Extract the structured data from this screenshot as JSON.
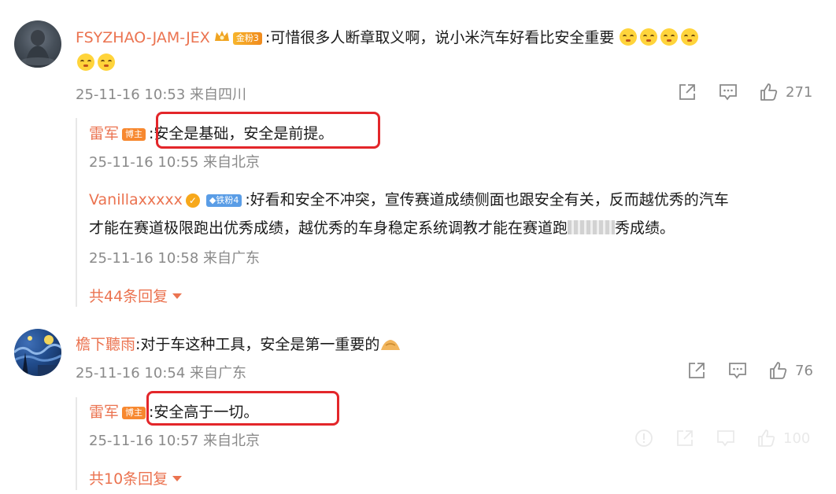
{
  "comments": [
    {
      "user": "FSYZHAO-JAM-JEX",
      "badge": "金粉3",
      "text_line1": ":可惜很多人断章取义啊，说小米汽车好看比安全重要",
      "meta": "25-11-16 10:53 来自四川",
      "likes": "271",
      "replies": [
        {
          "user": "雷军",
          "badge": "博主",
          "text": ":安全是基础，安全是前提。",
          "meta": "25-11-16 10:55 来自北京"
        },
        {
          "user": "Vanillaxxxxx",
          "badge": "铁粉4",
          "text_line1": ":好看和安全不冲突，宣传赛道成绩侧面也跟安全有关，反而越优秀的汽车",
          "text_line2a": "才能在赛道极限跑出优秀成绩，越优秀的车身稳定系统调教才能在赛道跑",
          "text_line2b": "秀成绩。",
          "meta": "25-11-16 10:58 来自广东"
        }
      ],
      "more_replies": "共44条回复"
    },
    {
      "user": "檐下聽雨",
      "text": ":对于车这种工具，安全是第一重要的",
      "meta": "25-11-16 10:54 来自广东",
      "likes": "76",
      "replies": [
        {
          "user": "雷军",
          "badge": "博主",
          "text": ":安全高于一切。",
          "meta": "25-11-16 10:57 来自北京",
          "likes": "100"
        }
      ],
      "more_replies": "共10条回复"
    }
  ],
  "colors": {
    "username": "#eb7350",
    "meta": "#8a8a8a",
    "highlight_box": "#e3262a"
  },
  "icons": [
    "share-icon",
    "comment-icon",
    "like-icon",
    "report-icon",
    "crown-icon",
    "verified-icon",
    "diamond-icon",
    "thinking-emoji",
    "bow-emoji",
    "caret-down-icon"
  ]
}
